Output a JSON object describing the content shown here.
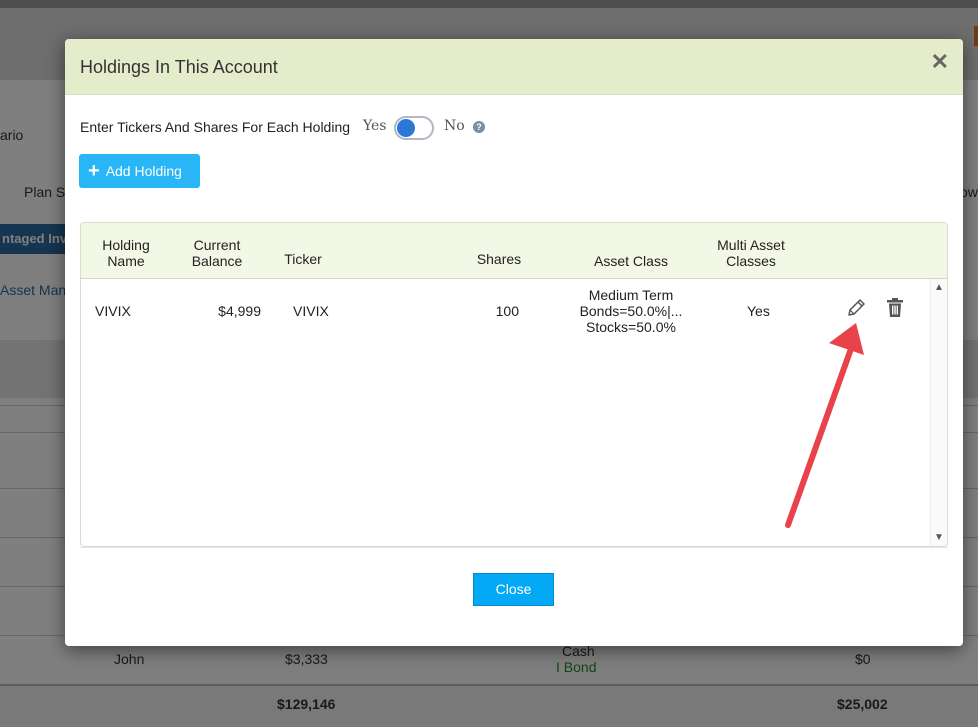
{
  "background": {
    "left_texts": [
      "ario",
      "Plan S",
      "ntaged Inv",
      "Asset Manu"
    ],
    "right_text": "ow",
    "bottom_row": {
      "name": "John",
      "balance": "$3,333",
      "asset1": "Cash",
      "asset2": "I Bond",
      "amount": "$0"
    },
    "totals": {
      "balance": "$129,146",
      "amount": "$25,002"
    }
  },
  "modal": {
    "title": "Holdings In This Account",
    "close_icon": "close-icon",
    "prompt": "Enter Tickers And Shares For Each Holding",
    "toggle": {
      "yes_label": "Yes",
      "no_label": "No",
      "state": "yes"
    },
    "help_icon": "?",
    "add_button": {
      "icon": "+",
      "label": "Add Holding"
    },
    "table": {
      "headers": {
        "holding_name": [
          "Holding",
          "Name"
        ],
        "current_balance": [
          "Current",
          "Balance"
        ],
        "ticker": "Ticker",
        "shares": "Shares",
        "asset_class": "Asset Class",
        "multi_asset": [
          "Multi Asset",
          "Classes"
        ]
      },
      "rows": [
        {
          "holding_name": "VIVIX",
          "current_balance": "$4,999",
          "ticker": "VIVIX",
          "shares": "100",
          "asset_class": [
            "Medium Term",
            "Bonds=50.0%|...",
            "Stocks=50.0%"
          ],
          "multi_asset": "Yes",
          "actions": [
            "pencil-icon",
            "trash-icon"
          ]
        }
      ]
    },
    "close_button": "Close"
  },
  "colors": {
    "header_bg": "#e5eccc",
    "button_blue": "#29b6f6",
    "arrow_red": "#e8424b",
    "toggle_blue": "#2b77d6"
  }
}
